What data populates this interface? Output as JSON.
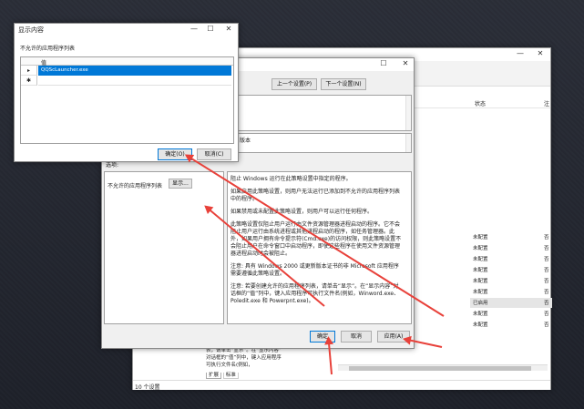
{
  "back_window": {
    "status_header": "状态",
    "comment_header": "注",
    "rows": [
      "未配置",
      "未配置",
      "未配置",
      "未配置",
      "未配置",
      "未配置",
      "已启用",
      "未配置",
      "未配置"
    ],
    "comment_col": [
      "否",
      "否",
      "否",
      "否",
      "否",
      "否",
      "否",
      "否",
      "否"
    ],
    "partial_help": [
      "表，请单击“显示”。在“显示内容”",
      "对话框的“值”列中，键入应用程序",
      "可执行文件名(例如，"
    ],
    "tabs": [
      "扩展",
      "标准"
    ],
    "footer": "10 个设置"
  },
  "policy_dialog": {
    "prev_label": "上一个设置(P)",
    "next_label": "下一个设置(N)",
    "version_fragment": "版本",
    "options_label": "选项:",
    "list_label": "不允许的应用程序列表",
    "show_label": "显示...",
    "help_paragraphs": [
      "阻止 Windows 运行在此策略设置中指定的程序。",
      "如果启用此策略设置，则用户无法运行已添加到不允许的应用程序列表中的程序。",
      "如果禁用或未配置此策略设置，则用户可以运行任何程序。",
      "此策略设置仅阻止用户运行由文件资源管理器进程启动的程序。它不会阻止用户运行由系统进程或其他进程启动的程序，如任务管理器。此外，如果用户拥有命令提示符(Cmd.exe)的访问权限，则此策略设置不会阻止用户在命令窗口中启动程序，即使这些程序在使用文件资源管理器进程启动时会被阻止。",
      "注意: 具有 Windows 2000 或更新版本证书的非 Microsoft 应用程序需要遵循此策略设置。",
      "注意: 若要创建允许的应用程序列表，请单击“显示”。在“显示内容”对话框的“值”列中，键入应用程序可执行文件名(例如，Winword.exe、Poledit.exe 和 Powerpnt.exe)。"
    ],
    "ok_label": "确定",
    "cancel_label": "取消",
    "apply_label": "应用(A)"
  },
  "show_contents": {
    "title": "显示内容",
    "list_label": "不允许的应用程序列表",
    "column_header": "值",
    "values": [
      "QQScLauncher.exe",
      ""
    ],
    "ok_label": "确定(O)",
    "cancel_label": "取消(C)"
  },
  "colors": {
    "arrow": "#e8413a",
    "selection": "#0078d7",
    "background": "#252830"
  },
  "icons": [
    "minimize-icon",
    "maximize-icon",
    "close-icon",
    "row-pointer-icon",
    "new-row-icon"
  ]
}
